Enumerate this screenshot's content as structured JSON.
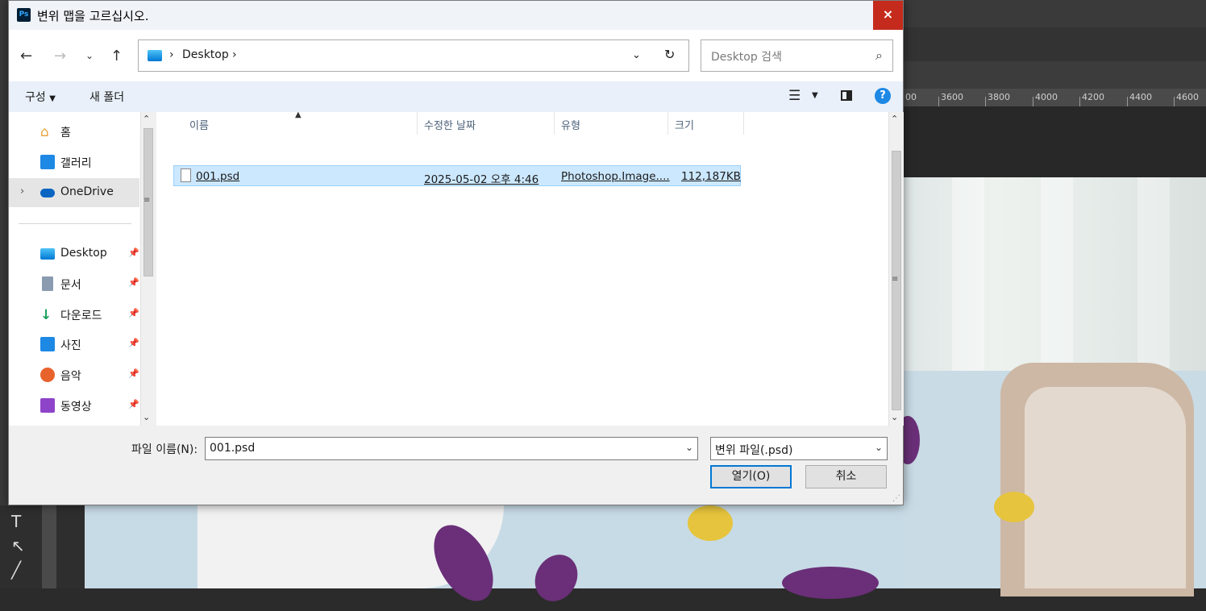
{
  "dialog": {
    "title": "변위 맵을 고르십시오.",
    "app_icon": "Ps",
    "close_label": "×"
  },
  "nav": {
    "back_icon": "arrow-left-icon",
    "forward_icon": "arrow-right-icon",
    "recent_icon": "chevron-down-icon",
    "up_icon": "arrow-up-icon",
    "breadcrumb_sep": "›",
    "address": "Desktop",
    "search_placeholder": "Desktop 검색"
  },
  "toolbar": {
    "organize": "구성",
    "new_folder": "새 폴더",
    "help": "?"
  },
  "sidebar": {
    "items": [
      {
        "label": "홈",
        "icon": "home-icon"
      },
      {
        "label": "갤러리",
        "icon": "gallery-icon"
      },
      {
        "label": "OneDrive",
        "icon": "cloud-icon"
      },
      {
        "label": "Desktop",
        "icon": "desktop-icon"
      },
      {
        "label": "문서",
        "icon": "document-icon"
      },
      {
        "label": "다운로드",
        "icon": "download-icon"
      },
      {
        "label": "사진",
        "icon": "picture-icon"
      },
      {
        "label": "음악",
        "icon": "music-icon"
      },
      {
        "label": "동영상",
        "icon": "video-icon"
      }
    ]
  },
  "columns": [
    "이름",
    "수정한 날짜",
    "유형",
    "크기"
  ],
  "files": [
    {
      "name": "001.psd",
      "modified": "2025-05-02 오후 4:46",
      "type": "Photoshop.Image....",
      "size": "112,187KB"
    }
  ],
  "footer": {
    "filename_label": "파일 이름(N):",
    "filename_value": "001.psd",
    "filetype_value": "변위 파일(.psd)",
    "open_label": "열기(O)",
    "cancel_label": "취소"
  },
  "ruler": [
    "00",
    "3600",
    "3800",
    "4000",
    "4200",
    "4400",
    "4600"
  ],
  "colors": {
    "accent": "#0078d4",
    "selection": "#cce8ff",
    "close": "#c42b1c"
  }
}
